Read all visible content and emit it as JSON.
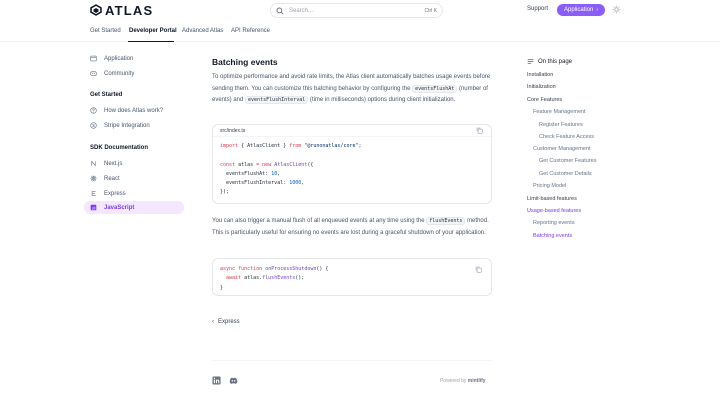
{
  "header": {
    "logo_text": "ATLAS",
    "search_placeholder": "Search...",
    "search_shortcut": "Ctrl K",
    "support": "Support",
    "application_button": "Application",
    "accent": "#8b5cf6"
  },
  "tabs": [
    {
      "label": "Get Started"
    },
    {
      "label": "Developer Portal"
    },
    {
      "label": "Advanced Atlas"
    },
    {
      "label": "API Reference"
    }
  ],
  "sidebar": {
    "top_items": [
      {
        "label": "Application",
        "icon": "window-icon"
      },
      {
        "label": "Community",
        "icon": "community-icon"
      }
    ],
    "sections": [
      {
        "heading": "Get Started",
        "items": [
          {
            "label": "How does Atlas work?",
            "icon": "question-icon"
          },
          {
            "label": "Stripe Integration",
            "icon": "stripe-icon"
          }
        ]
      },
      {
        "heading": "SDK Documentation",
        "items": [
          {
            "label": "Next.js",
            "icon": "nextjs-icon"
          },
          {
            "label": "React",
            "icon": "react-icon"
          },
          {
            "label": "Express",
            "icon": "express-icon"
          },
          {
            "label": "JavaScript",
            "icon": "javascript-icon"
          }
        ]
      }
    ]
  },
  "main": {
    "title": "Batching events",
    "para1_a": "To optimize performance and avoid rate limits, the Atlas client automatically batches usage events before sending them. You can customize this batching behavior by configuring the",
    "para1_code1": "eventsFlushAt",
    "para1_b": "(number of events) and",
    "para1_code2": "eventsFlushInterval",
    "para1_c": "(time in milliseconds) options during client initialization.",
    "code1": {
      "filename": "src/index.ts",
      "line1_kw1": "import",
      "line1_mid": " { AtlasClient } ",
      "line1_kw2": "from",
      "line1_str": "\"@runonatlas/core\"",
      "line1_end": ";",
      "line3_kw": "const",
      "line3_var": " atlas ",
      "line3_eq": "= ",
      "line3_new": "new",
      "line3_fn": " AtlasClient",
      "line3_end": "({",
      "line4_key": "  eventsFlushAt: ",
      "line4_num": "10",
      "line4_end": ",",
      "line5_key": "  eventsFlushInterval: ",
      "line5_num": "1000",
      "line5_end": ",",
      "line6": "});"
    },
    "para2_a": "You can also trigger a manual flush of all enqueued events at any time using the",
    "para2_code": "flushEvents",
    "para2_b": "method. This is particularly useful for ensuring no events are lost during a graceful shutdown of your application.",
    "code2": {
      "line1_kw1": "async",
      "line1_kw2": "function",
      "line1_fn": "onProcessShutdown",
      "line1_end": "() {",
      "line2_kw": "  await",
      "line2_obj": " atlas.",
      "line2_fn": "flushEvents",
      "line2_end": "();",
      "line3": "}"
    },
    "prev_link": "Express"
  },
  "footer": {
    "powered_prefix": "Powered by",
    "powered_brand": "mintlify"
  },
  "toc": {
    "title": "On this page",
    "items": [
      {
        "label": "Installation",
        "level": 0
      },
      {
        "label": "Initialization",
        "level": 0
      },
      {
        "label": "Core Features",
        "level": 0
      },
      {
        "label": "Feature Management",
        "level": 1
      },
      {
        "label": "Register Features",
        "level": 2
      },
      {
        "label": "Check Feature Access",
        "level": 2
      },
      {
        "label": "Customer Management",
        "level": 1
      },
      {
        "label": "Get Customer Features",
        "level": 2
      },
      {
        "label": "Get Customer Details",
        "level": 2
      },
      {
        "label": "Pricing Model",
        "level": 1
      },
      {
        "label": "Limit-based features",
        "level": 0
      },
      {
        "label": "Usage-based features",
        "level": 0,
        "active": true
      },
      {
        "label": "Reporting events",
        "level": 1
      },
      {
        "label": "Batching events",
        "level": 1,
        "active": true
      }
    ]
  }
}
